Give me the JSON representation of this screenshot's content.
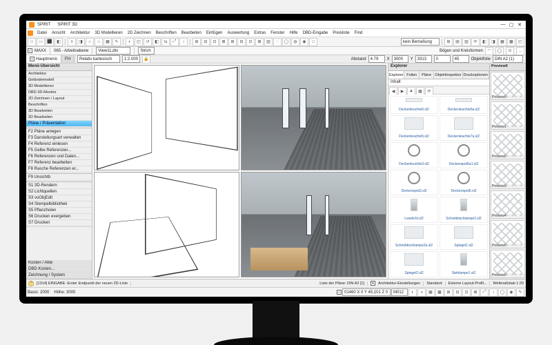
{
  "app": {
    "name": "SPIRIT",
    "doc_title": "SPIRIT 3D"
  },
  "window": {
    "min": "—",
    "max": "▢",
    "close": "✕"
  },
  "menu": [
    "Datei",
    "Ansicht",
    "Architektur",
    "3D Modellieren",
    "2D Zeichnen",
    "Beschriften",
    "Bearbeiten",
    "Einfügen",
    "Auswertung",
    "Extras",
    "Fenster",
    "Hilfe",
    "DBD-Eingabe",
    "Preisliste",
    "Find"
  ],
  "toolbar1": {
    "btns": [
      "□",
      "▭",
      "⬛",
      "◧",
      "≡",
      "◨",
      "⌂",
      "⌂",
      "▦",
      "✎",
      "◐",
      "◰",
      "↺",
      "◧",
      "⇆",
      "⤢",
      "↕",
      "⊞",
      "⊟",
      "⊡",
      "⊠",
      "⊞",
      "⊟",
      "⊡",
      "⊠",
      "▥",
      "◌",
      "◯",
      "◍",
      "◉",
      "□",
      "▢",
      "◻"
    ],
    "right_label": "kein Bemaßung",
    "layer_btns": [
      "⊞",
      "▤",
      "▥",
      "⟳",
      "◧",
      "◨",
      "▦",
      "▩",
      "◰",
      "◱",
      "◲",
      "◳"
    ]
  },
  "optbar": {
    "maxx_label": "MAXX",
    "arb_label": "065 - Arbeitsebene",
    "sheet_label": "View11.dtv",
    "strich_label": "Strich",
    "bogen_label": "Bögen und Kreisformen"
  },
  "tabbar": {
    "tabs": [
      {
        "label": "Hauptmenü",
        "active": true
      },
      {
        "label": "FH",
        "active": false
      }
    ],
    "scale_mode": "Relativ kartesisch",
    "scale": "1:2.000",
    "abstand_label": "Abstand",
    "abstand_val": "4.79",
    "x_label": "X",
    "x_val": "3000",
    "y_label": "Y",
    "y_val": "3313",
    "extra1": "0",
    "extra2": "45",
    "obj_label": "Objektfolie",
    "obj_val": "DIN A2 (1)"
  },
  "sidebar": {
    "title": "Menü-Übersicht",
    "cats": [
      "Architektur",
      "Geländemodell",
      "3D Modellieren",
      "DBD-3D-Monitor",
      "2D Zeichnen / Layout",
      "Beschriften",
      "3D Bearbeiten",
      "2D Bearbeiten"
    ],
    "active": "Pläne / Präsentation",
    "items": [
      "F2 Pläne anlegen",
      "F3 Darstellungsart verwalten",
      "F4 Referenz einlesen",
      "F5 Gelbe Referenzen...",
      "F6 Referenzen und Daten...",
      "F7 Referenz bearbeiten",
      "F8 Rasche Referenzen er...",
      "",
      "F9 Unsichtb",
      "",
      "S1 3D-Rendern",
      "S2 Lichtquellen",
      "S3 voObjEdit",
      "S4 Stempelbibliothek",
      "S5 Pflanzholen",
      "S6 Drucken evergeben",
      "S7 Drucken"
    ],
    "bottom": [
      "Kosten / Akte",
      "DBD Kosten...",
      "Zeichnung / System"
    ]
  },
  "explorer": {
    "title": "Explorer",
    "tabs": [
      "Explorer",
      "Folien",
      "Pläne",
      "Objektinspektor",
      "Druckoptionen"
    ],
    "sub": "Inhalt",
    "items": [
      "Deckenleuchte6.sl2",
      "Deckenleuchte5a.sl2",
      "Deckenleuchte5.sl2",
      "Deckenleuchte7a.sl2",
      "Deckenleuchte3.sl2",
      "Deckenspot5a1.sl2",
      "Deckenspot3.sl2",
      "Deckenspot5.sl2",
      "Leselicht.sl2",
      "Schreibtischlampe2.sl2",
      "Schreibtischlampe2a.sl2",
      "Spiegel1.sl2",
      "Spiegel2.sl2",
      "Stehlampe1.sl2"
    ]
  },
  "preview": {
    "title": "Preview0",
    "labels": [
      "Preview0",
      "Preview1",
      "Preview2",
      "Preview3",
      "Preview4",
      "Preview5",
      "Preview6"
    ]
  },
  "status": {
    "prompt": "[1314] EINGABE: Erster Endpunkt der neuen 2D-Linie",
    "plane": "Liste der Pläne: DIN A2 [1]",
    "arch": "Architektur-Einstellungen",
    "std": "Standard",
    "layout": "Externe Layout-Profil...",
    "ratio": "Weltmaßstab 1:20",
    "basis_label": "Basis: 2000",
    "hoehe_label": "Höhe: 3000",
    "nums": "01460 X 0 Y 45,101 Z 0",
    "unit": "M012"
  }
}
